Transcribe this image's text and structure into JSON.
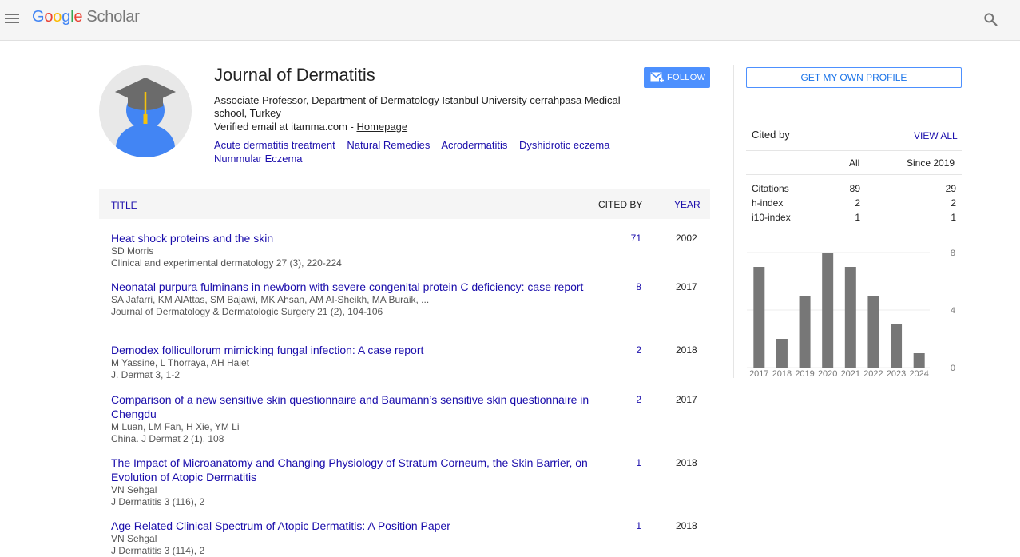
{
  "header": {
    "logo_google": [
      "G",
      "o",
      "o",
      "g",
      "l",
      "e"
    ],
    "logo_scholar": "Scholar"
  },
  "profile": {
    "name": "Journal of Dermatitis",
    "affiliation": "Associate Professor, Department of Dermatology Istanbul University cerrahpasa Medical school, Turkey",
    "email_text": "Verified email at itamma.com - ",
    "homepage_label": "Homepage",
    "interests": [
      "Acute dermatitis treatment",
      "Natural Remedies",
      "Acrodermatitis",
      "Dyshidrotic eczema",
      "Nummular Eczema"
    ],
    "follow_label": "FOLLOW"
  },
  "sidebar": {
    "get_profile_label": "GET MY OWN PROFILE",
    "cited_by_title": "Cited by",
    "view_all_label": "VIEW ALL",
    "col_all": "All",
    "col_since": "Since 2019",
    "stats": [
      {
        "label": "Citations",
        "all": "89",
        "since": "29"
      },
      {
        "label": "h-index",
        "all": "2",
        "since": "2"
      },
      {
        "label": "i10-index",
        "all": "1",
        "since": "1"
      }
    ]
  },
  "table": {
    "col_title": "TITLE",
    "col_cited": "CITED BY",
    "col_year": "YEAR",
    "rows": [
      {
        "title": "Heat shock proteins and the skin",
        "authors": "SD Morris",
        "venue": "Clinical and experimental dermatology 27 (3), 220-224",
        "cited": "71",
        "year": "2002"
      },
      {
        "title": "Neonatal purpura fulminans in newborn with severe congenital protein C deficiency: case report",
        "authors": "SA Jafarri, KM AlAttas, SM Bajawi, MK Ahsan, AM Al-Sheikh, MA Buraik, ...",
        "venue": "Journal of Dermatology & Dermatologic Surgery 21 (2), 104-106",
        "cited": "8",
        "year": "2017"
      },
      {
        "title": "Demodex follicullorum mimicking fungal infection: A case report",
        "authors": "M Yassine, L Thorraya, AH Haiet",
        "venue": "J. Dermat 3, 1-2",
        "cited": "2",
        "year": "2018"
      },
      {
        "title": "Comparison of a new sensitive skin questionnaire and Baumann’s sensitive skin questionnaire in Chengdu",
        "authors": "M Luan, LM Fan, H Xie, YM Li",
        "venue": "China. J Dermat 2 (1), 108",
        "cited": "2",
        "year": "2017"
      },
      {
        "title": "The Impact of Microanatomy and Changing Physiology of Stratum Corneum, the Skin Barrier, on Evolution of Atopic Dermatitis",
        "authors": "VN Sehgal",
        "venue": "J Dermatitis 3 (116), 2",
        "cited": "1",
        "year": "2018"
      },
      {
        "title": "Age Related Clinical Spectrum of Atopic Dermatitis: A Position Paper",
        "authors": "VN Sehgal",
        "venue": "J Dermatitis 3 (114), 2",
        "cited": "1",
        "year": "2018"
      }
    ]
  },
  "chart_data": {
    "type": "bar",
    "categories": [
      "2017",
      "2018",
      "2019",
      "2020",
      "2021",
      "2022",
      "2023",
      "2024"
    ],
    "values": [
      7,
      2,
      5,
      8,
      7,
      5,
      3,
      1
    ],
    "yticks": [
      "0",
      "4",
      "8"
    ],
    "ylim": [
      0,
      8
    ],
    "bar_color": "#777777"
  }
}
